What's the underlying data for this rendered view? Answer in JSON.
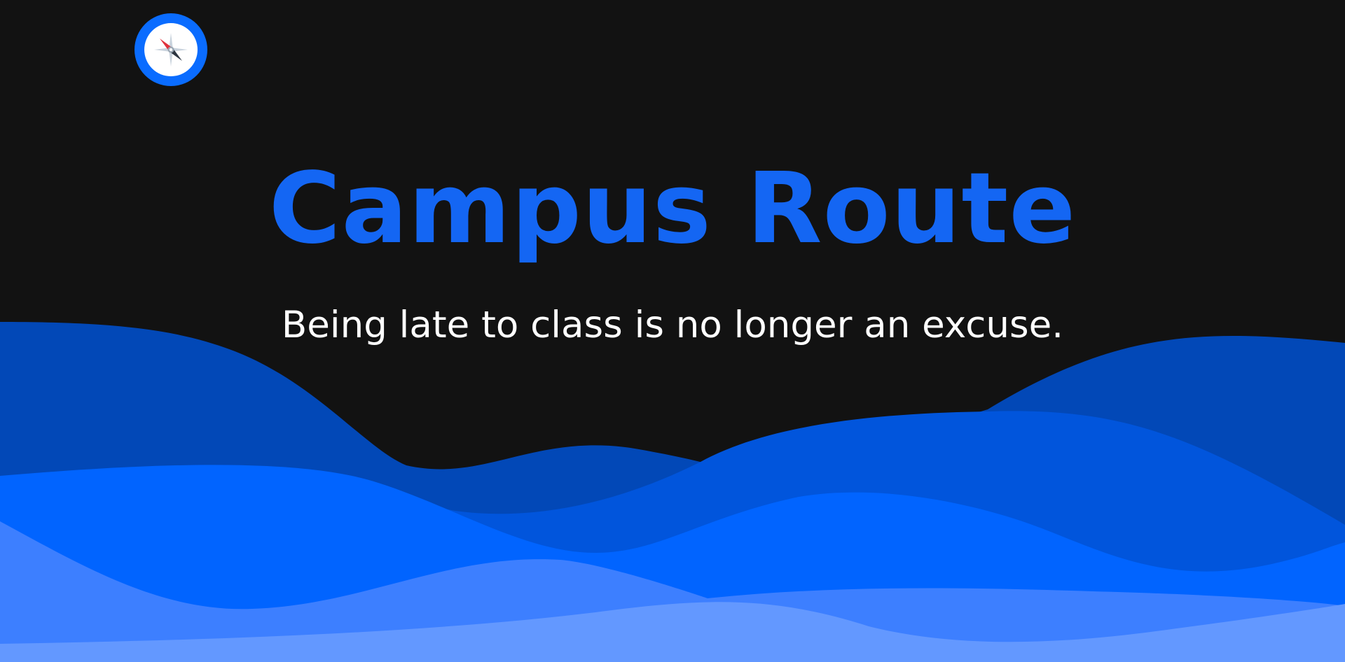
{
  "hero": {
    "title": "Campus Route",
    "subtitle": "Being late to class is no longer an excuse."
  },
  "logo": {
    "icon": "compass-icon"
  },
  "colors": {
    "background": "#121212",
    "brand": "#0a6cff",
    "title": "#1466f3",
    "subtitle": "#ffffff",
    "wave_dark": "#0248b7",
    "wave_mid": "#0155dc",
    "wave_primary": "#0164ff",
    "wave_light": "#3d7fff",
    "wave_lightest": "#6398ff"
  }
}
